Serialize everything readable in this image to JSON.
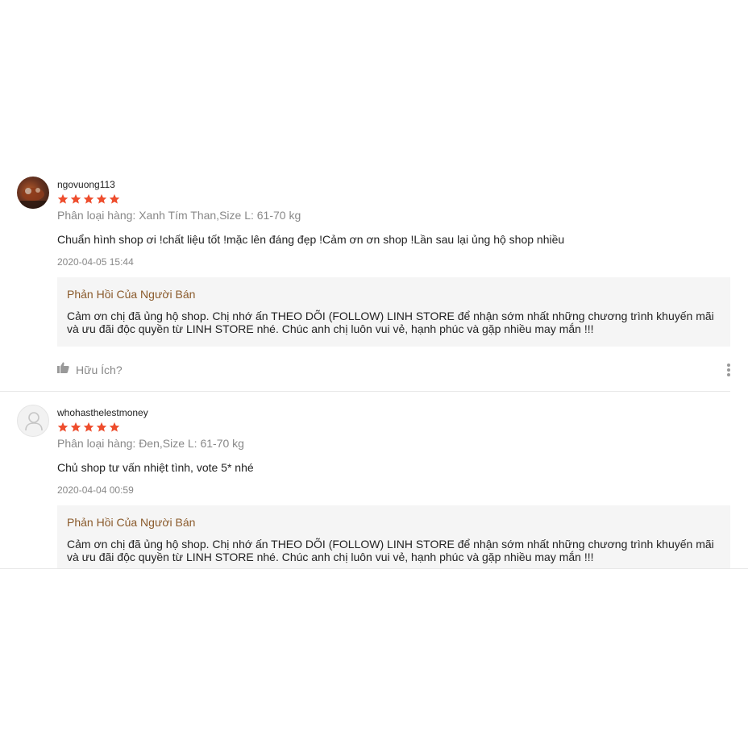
{
  "reviews": [
    {
      "username": "ngovuong113",
      "rating": 5,
      "variation": "Phân loại hàng: Xanh Tím Than,Size L: 61-70 kg",
      "comment": "Chuẩn hình shop ơi !chất liệu tốt !mặc lên đáng đẹp !Cảm ơn ơn shop !Lần sau lại ủng hộ shop nhiều",
      "datetime": "2020-04-05 15:44",
      "reply_title": "Phản Hồi Của Người Bán",
      "reply_line1": "Cảm ơn chị đã ủng hộ shop. Chị nhớ ấn THEO DÕI (FOLLOW) LINH STORE để nhận sớm nhất những chương trình khuyến mãi",
      "reply_line2": "và ưu đãi độc quyền từ LINH STORE nhé. Chúc anh chị luôn vui vẻ, hạnh phúc và gặp nhiều may mắn !!!",
      "helpful_label": "Hữu Ích?"
    },
    {
      "username": "whohasthelestmoney",
      "rating": 5,
      "variation": "Phân loại hàng: Đen,Size L: 61-70 kg",
      "comment": "Chủ shop tư vấn nhiệt tình, vote 5*  nhé",
      "datetime": "2020-04-04 00:59",
      "reply_title": "Phản Hồi Của Người Bán",
      "reply_line1": "Cảm ơn chị đã ủng hộ shop. Chị nhớ ấn THEO DÕI (FOLLOW) LINH STORE để nhận sớm nhất những chương trình khuyến mãi",
      "reply_line2": "và ưu đãi độc quyền từ LINH STORE nhé. Chúc anh chị luôn vui vẻ, hạnh phúc và gặp nhiều may mắn !!!"
    }
  ],
  "colors": {
    "star": "#ee4d2d",
    "reply_title": "#8a5a2b",
    "muted_text": "#888888",
    "reply_bg": "#f5f5f5"
  },
  "icons": {
    "star": "star-icon",
    "like": "thumbs-up-icon",
    "more": "more-vertical-icon",
    "default_avatar": "user-icon"
  }
}
